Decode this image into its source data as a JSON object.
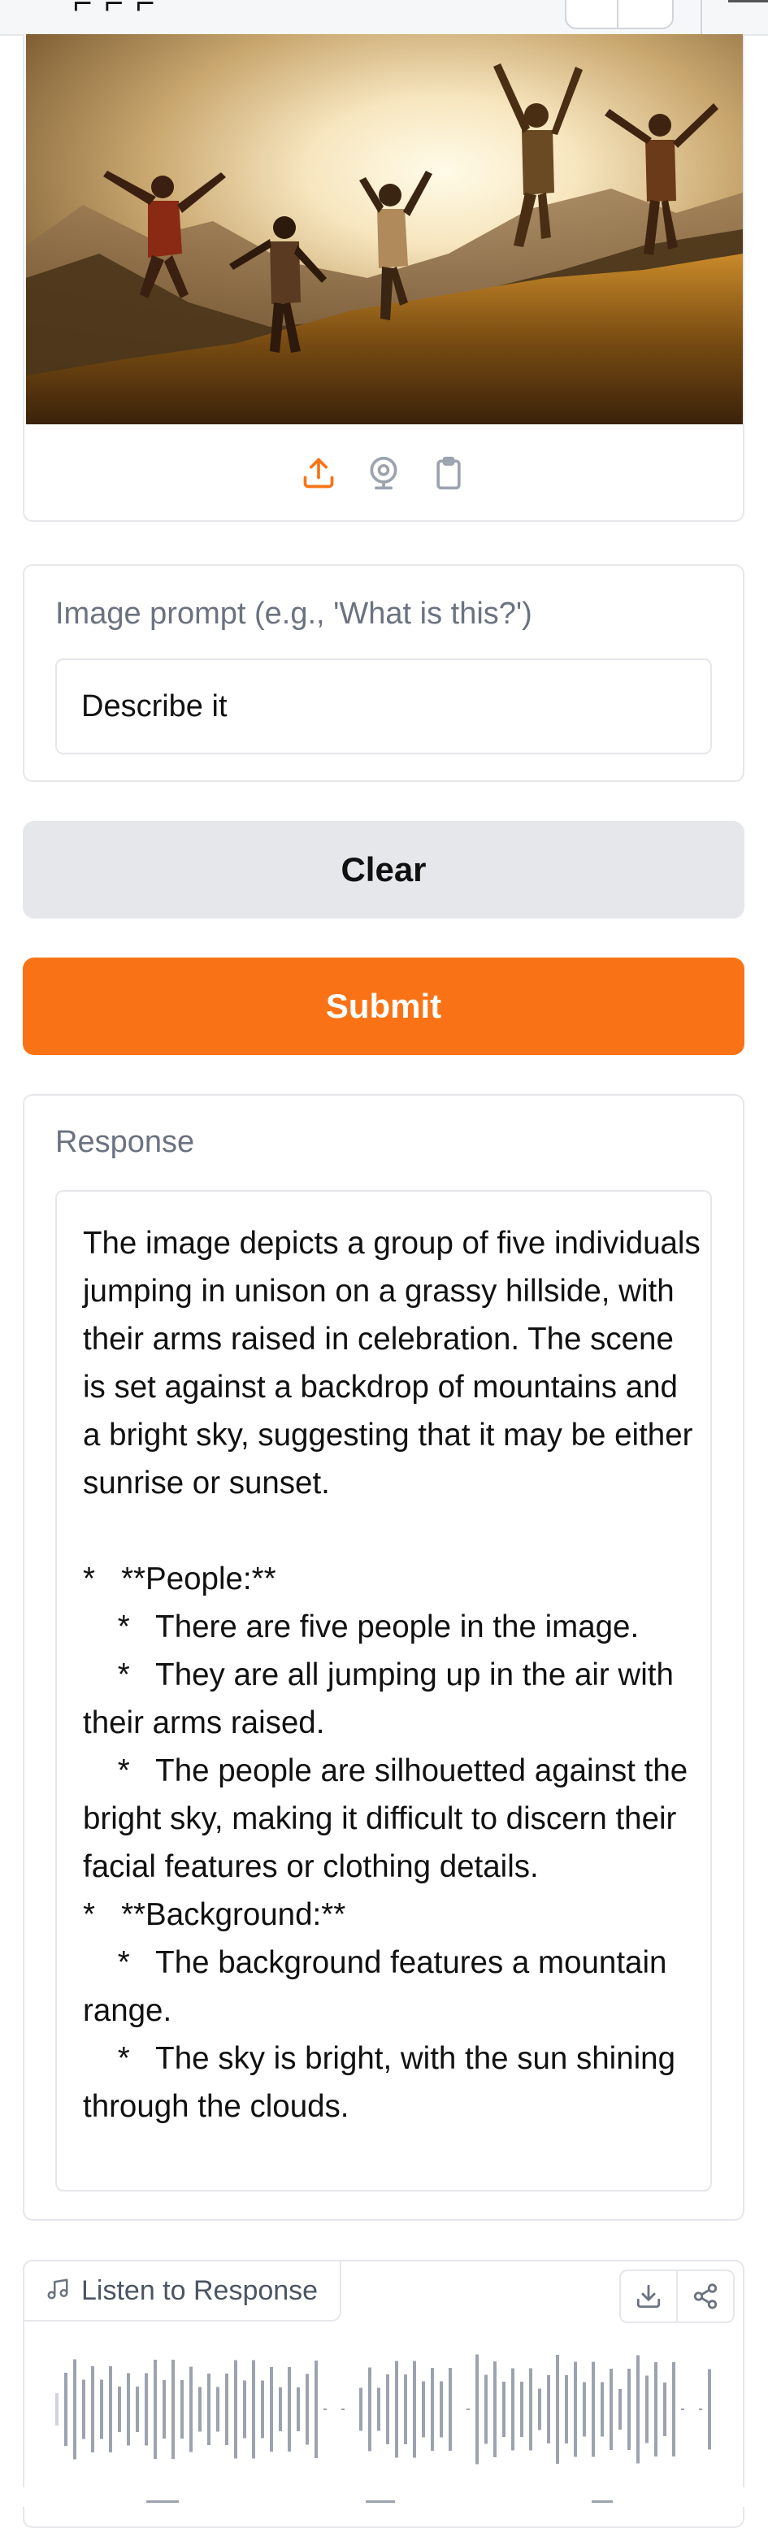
{
  "image_input": {
    "photo_alt": "group of five people jumping on a grassy hillside at sunset",
    "tools": [
      {
        "name": "upload-icon",
        "color": "#f97316"
      },
      {
        "name": "webcam-icon",
        "color": "#9ca3af"
      },
      {
        "name": "clipboard-icon",
        "color": "#9ca3af"
      }
    ]
  },
  "prompt": {
    "label": "Image prompt (e.g., 'What is this?')",
    "value": "Describe it"
  },
  "buttons": {
    "clear_label": "Clear",
    "submit_label": "Submit"
  },
  "response": {
    "label": "Response",
    "text": "The image depicts a group of five individuals jumping in unison on a grassy hillside, with their arms raised in celebration. The scene is set against a backdrop of mountains and a bright sky, suggesting that it may be either sunrise or sunset.\n\n*   **People:**\n    *   There are five people in the image.\n    *   They are all jumping up in the air with their arms raised.\n    *   The people are silhouetted against the bright sky, making it difficult to discern their facial features or clothing details.\n*   **Background:**\n    *   The background features a mountain range.\n    *   The sky is bright, with the sun shining through the clouds."
  },
  "audio": {
    "tab_label": "Listen to Response",
    "actions": [
      "download-icon",
      "share-icon"
    ]
  },
  "colors": {
    "accent": "#f97316",
    "border": "#e5e7eb",
    "muted_text": "#6b7280",
    "clear_bg": "#e5e7eb"
  }
}
